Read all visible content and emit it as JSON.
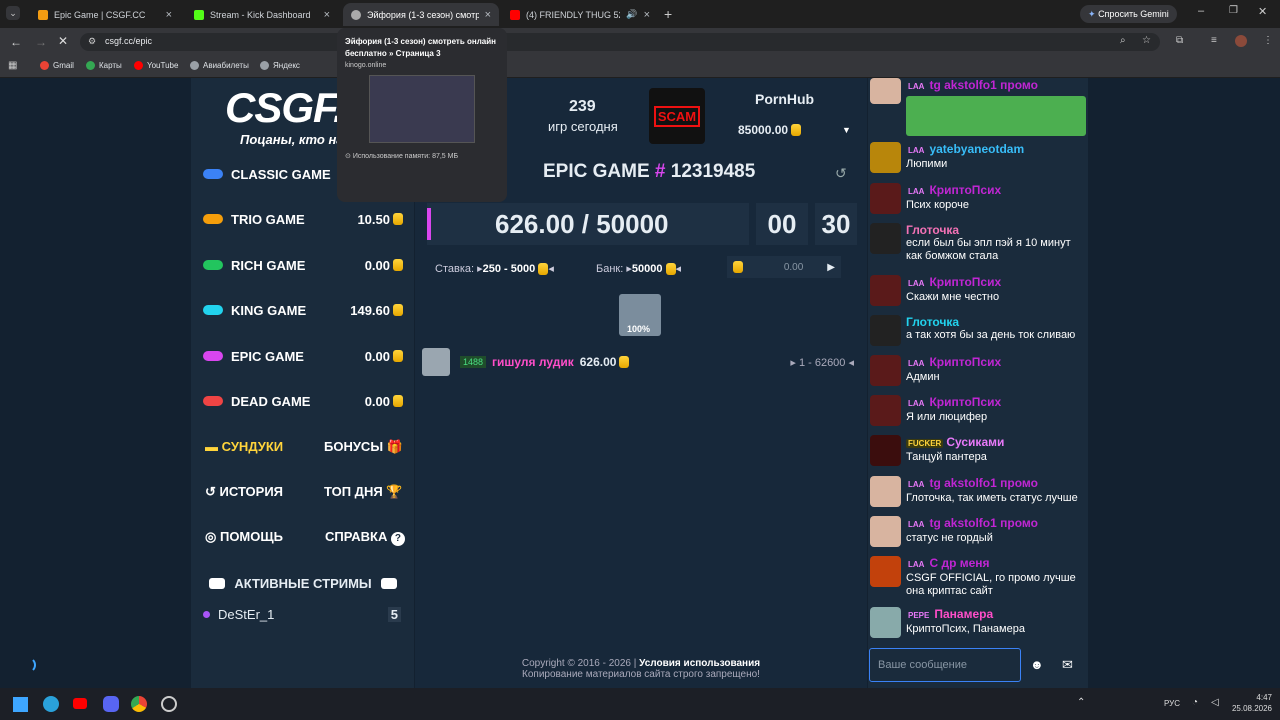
{
  "tabs": [
    {
      "label": "Epic Game | CSGF.CC",
      "active": false
    },
    {
      "label": "Stream - Kick Dashboard",
      "active": false
    },
    {
      "label": "Эйфория (1-3 сезон) смотреть",
      "active": true
    },
    {
      "label": "(4) FRIENDLY THUG 52 NGG",
      "active": false
    }
  ],
  "ask_gemini": "Спросить Gemini",
  "url": "csgf.cc/epic",
  "bookmarks": [
    "Gmail",
    "Карты",
    "YouTube",
    "Авиабилеты",
    "Яндекс"
  ],
  "tooltip": {
    "title": "Эйфория (1-3 сезон) смотреть онлайн бесплатно » Страница 3",
    "domain": "kinogo.online",
    "memory": "Использование памяти: 87,5 МБ"
  },
  "logo": {
    "text": "CSGF.C",
    "slogan": "Поцаны, кто на"
  },
  "games_today": {
    "count": "239",
    "label": "игр сегодня"
  },
  "scam": "SCAM",
  "top_user": {
    "name": "PornHub",
    "amount": "85000.00"
  },
  "menu": [
    {
      "label": "CLASSIC GAME",
      "value": "",
      "color": "#3b82f6"
    },
    {
      "label": "TRIO GAME",
      "value": "10.50",
      "color": "#f59e0b"
    },
    {
      "label": "RICH GAME",
      "value": "0.00",
      "color": "#22c55e"
    },
    {
      "label": "KING GAME",
      "value": "149.60",
      "color": "#22d3ee"
    },
    {
      "label": "EPIC GAME",
      "value": "0.00",
      "color": "#d946ef"
    },
    {
      "label": "DEAD GAME",
      "value": "0.00",
      "color": "#ef4444"
    }
  ],
  "extras": {
    "chests": "СУНДУКИ",
    "bonuses": "БОНУСЫ",
    "history": "ИСТОРИЯ",
    "top_day": "ТОП ДНЯ",
    "help": "ПОМОЩЬ",
    "info": "СПРАВКА"
  },
  "streams": {
    "title": "АКТИВНЫЕ СТРИМЫ",
    "streamer": "DeStEr_1",
    "count": "5"
  },
  "game": {
    "title": "EPIC GAME",
    "hash": "#",
    "id": "12319485",
    "bank": "626.00 / 50000",
    "min": "00",
    "sec": "30",
    "bet_label": "Ставка:",
    "bet_range": "250 - 5000",
    "bank_label": "Банк:",
    "bank_value": "50000",
    "input_value": "0.00",
    "chance": "100%"
  },
  "player": {
    "level": "1488",
    "name": "гишуля лудик",
    "amount": "626.00",
    "tickets": "1 - 62600"
  },
  "footer": {
    "copyright": "Copyright © 2016 - 2026 |",
    "terms": "Условия использования",
    "notice": "Копирование материалов сайта строго запрещено!"
  },
  "chat": [
    {
      "lvl": "LAA",
      "name": "tg akstolfo1 промо",
      "text": "",
      "ncolor": "#c026d3",
      "av": "#d8b4a0"
    },
    {
      "lvl": "LAA",
      "name": "yatebyaneotdam",
      "text": "Люпими",
      "ncolor": "#38bdf8",
      "av": "#b8860b"
    },
    {
      "lvl": "LAA",
      "name": "КриптоПсих",
      "text": "Псих короче",
      "ncolor": "#c026d3",
      "av": "#5a1a1a"
    },
    {
      "lvl": "",
      "name": "Глоточка",
      "text": "если был бы эпл пэй я 10 минут как бомжом стала",
      "ncolor": "#f472b6",
      "av": "#222"
    },
    {
      "lvl": "LAA",
      "name": "КриптоПсих",
      "text": "Скажи мне честно",
      "ncolor": "#c026d3",
      "av": "#5a1a1a"
    },
    {
      "lvl": "",
      "name": "Глоточка",
      "text": "а так хотя бы за день ток сливаю",
      "ncolor": "#22d3ee",
      "av": "#222"
    },
    {
      "lvl": "LAA",
      "name": "КриптоПсих",
      "text": "Админ",
      "ncolor": "#c026d3",
      "av": "#5a1a1a"
    },
    {
      "lvl": "LAA",
      "name": "КриптоПсих",
      "text": "Я или люцифер",
      "ncolor": "#c026d3",
      "av": "#5a1a1a"
    },
    {
      "lvl": "FUCKER",
      "name": "Сусиками",
      "text": "Танцуй пантера",
      "ncolor": "#e879f9",
      "av": "#3b0d0d"
    },
    {
      "lvl": "LAA",
      "name": "tg akstolfo1 промо",
      "text": "Глоточка, так иметь статус лучше",
      "ncolor": "#c026d3",
      "av": "#d8b4a0"
    },
    {
      "lvl": "LAA",
      "name": "tg akstolfo1 промо",
      "text": "статус не гордый",
      "ncolor": "#c026d3",
      "av": "#d8b4a0"
    },
    {
      "lvl": "LAA",
      "name": "С др меня",
      "text": "CSGF OFFICIAL, го промо лучше она криптас сайт",
      "ncolor": "#c026d3",
      "av": "#c2410c"
    },
    {
      "lvl": "PEPE",
      "name": "Панамера",
      "text": "КриптоПсих, Панамера",
      "ncolor": "#ff4ec9",
      "av": "#8aa"
    }
  ],
  "chat_placeholder": "Ваше сообщение",
  "tray": {
    "lang": "РУС",
    "time": "4:47",
    "date": "25.08.2026"
  }
}
